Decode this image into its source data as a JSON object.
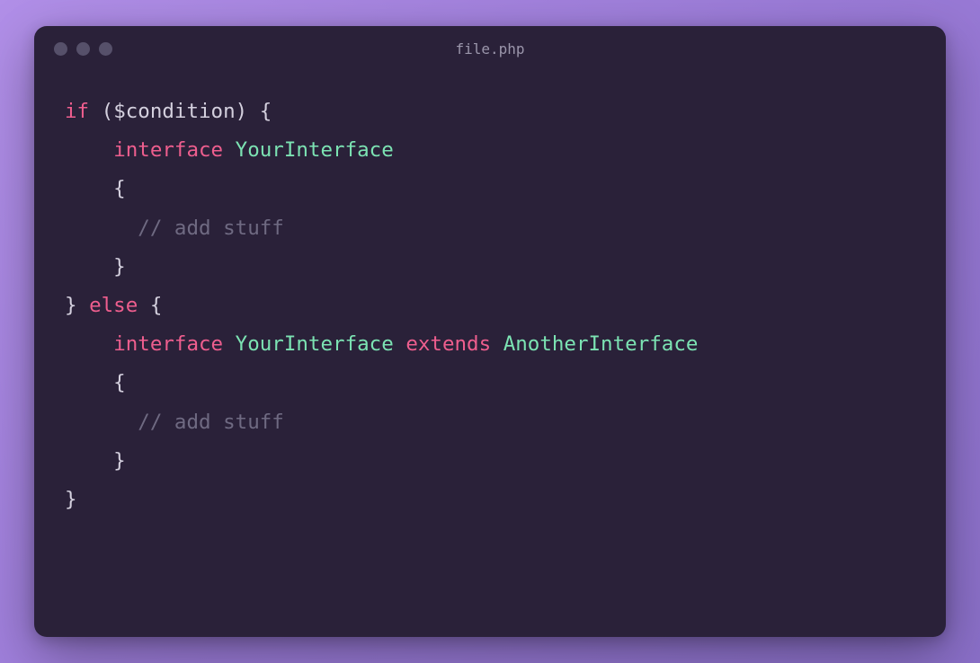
{
  "window": {
    "filename": "file.php"
  },
  "colors": {
    "keyword": "#ee5e8e",
    "classname": "#7ce3b3",
    "comment": "#6f6a82",
    "default": "#d4d0de",
    "background": "#2a2139"
  },
  "code": {
    "lines": [
      [
        {
          "t": "if",
          "c": "kw"
        },
        {
          "t": " (",
          "c": "pn"
        },
        {
          "t": "$condition",
          "c": "var"
        },
        {
          "t": ") {",
          "c": "pn"
        }
      ],
      [
        {
          "t": "    ",
          "c": "pn"
        },
        {
          "t": "interface",
          "c": "kw"
        },
        {
          "t": " ",
          "c": "pn"
        },
        {
          "t": "YourInterface",
          "c": "cls"
        }
      ],
      [
        {
          "t": "    {",
          "c": "pn"
        }
      ],
      [
        {
          "t": "      ",
          "c": "pn"
        },
        {
          "t": "// add stuff",
          "c": "cmt"
        }
      ],
      [
        {
          "t": "    }",
          "c": "pn"
        }
      ],
      [
        {
          "t": "} ",
          "c": "pn"
        },
        {
          "t": "else",
          "c": "kw"
        },
        {
          "t": " {",
          "c": "pn"
        }
      ],
      [
        {
          "t": "    ",
          "c": "pn"
        },
        {
          "t": "interface",
          "c": "kw"
        },
        {
          "t": " ",
          "c": "pn"
        },
        {
          "t": "YourInterface",
          "c": "cls"
        },
        {
          "t": " ",
          "c": "pn"
        },
        {
          "t": "extends",
          "c": "kw"
        },
        {
          "t": " ",
          "c": "pn"
        },
        {
          "t": "AnotherInterface",
          "c": "cls"
        }
      ],
      [
        {
          "t": "    {",
          "c": "pn"
        }
      ],
      [
        {
          "t": "      ",
          "c": "pn"
        },
        {
          "t": "// add stuff",
          "c": "cmt"
        }
      ],
      [
        {
          "t": "    }",
          "c": "pn"
        }
      ],
      [
        {
          "t": "}",
          "c": "pn"
        }
      ]
    ]
  }
}
